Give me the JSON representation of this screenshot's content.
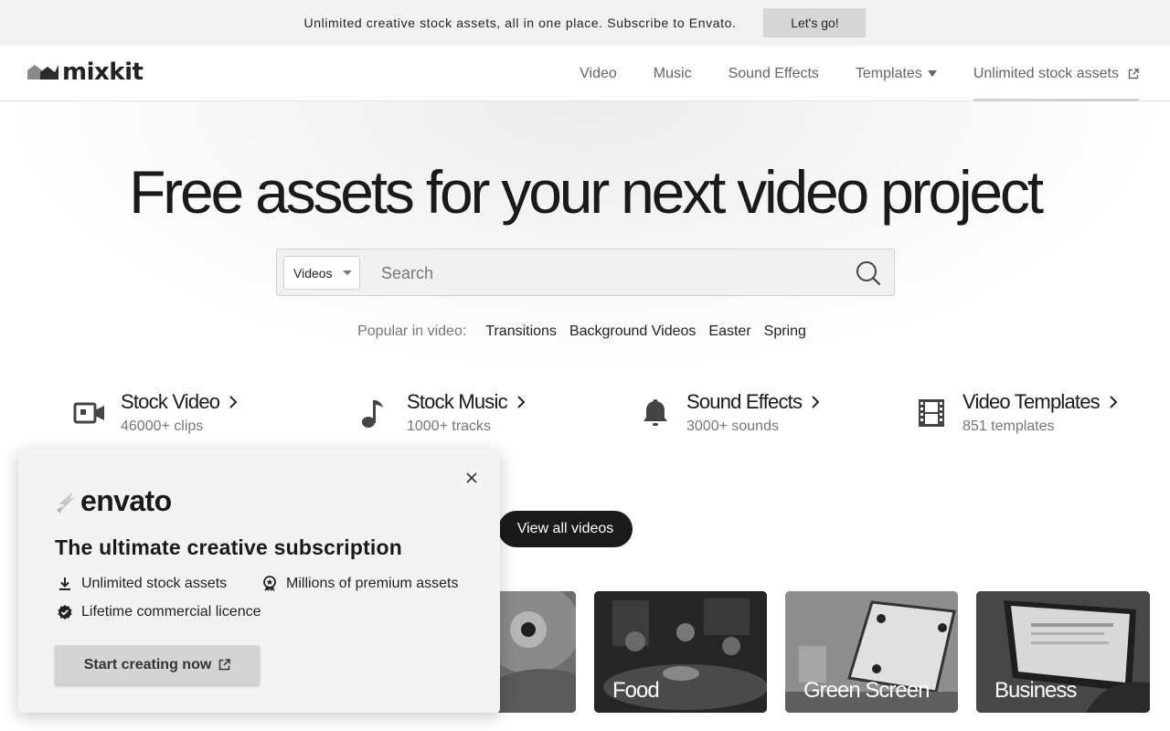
{
  "promo": {
    "text": "Unlimited creative stock assets, all in one place. Subscribe to Envato.",
    "button": "Let's go!"
  },
  "header": {
    "logo_text": "mixkit",
    "nav": [
      {
        "label": "Video"
      },
      {
        "label": "Music"
      },
      {
        "label": "Sound Effects"
      },
      {
        "label": "Templates",
        "icon": "caret-down-icon"
      },
      {
        "label": "Unlimited stock assets",
        "icon": "external-link-icon"
      }
    ]
  },
  "hero": {
    "title": "Free assets for your next video project"
  },
  "search": {
    "type_selected": "Videos",
    "placeholder": "Search",
    "value": ""
  },
  "popular": {
    "label": "Popular in video:",
    "links": [
      "Transitions",
      "Background Videos",
      "Easter",
      "Spring"
    ]
  },
  "categories": [
    {
      "title": "Stock Video",
      "count": "46000+ clips",
      "icon": "video-camera-icon"
    },
    {
      "title": "Stock Music",
      "count": "1000+ tracks",
      "icon": "music-note-icon"
    },
    {
      "title": "Sound Effects",
      "count": "3000+ sounds",
      "icon": "bell-icon"
    },
    {
      "title": "Video Templates",
      "count": "851 templates",
      "icon": "film-strip-icon"
    }
  ],
  "view_all": "View all videos",
  "thumbnails": [
    {
      "label": ""
    },
    {
      "label": "Food"
    },
    {
      "label": "Green Screen"
    },
    {
      "label": "Business"
    }
  ],
  "popup": {
    "logo_text": "envato",
    "title": "The ultimate creative subscription",
    "features": [
      {
        "label": "Unlimited stock assets",
        "icon": "download-icon"
      },
      {
        "label": "Millions of premium assets",
        "icon": "award-icon"
      },
      {
        "label": "Lifetime commercial licence",
        "icon": "verified-badge-icon"
      }
    ],
    "button": "Start creating now"
  },
  "colors": {
    "text_dark": "#1a1a1a",
    "text_muted": "#777777",
    "button_dark": "#1a1a1a",
    "banner_bg": "#f2f2f2"
  }
}
